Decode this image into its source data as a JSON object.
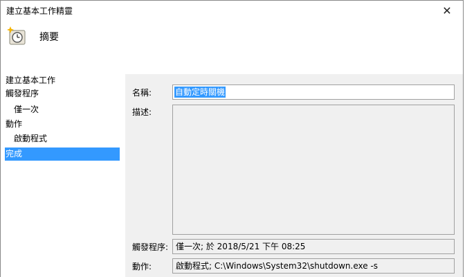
{
  "window": {
    "title": "建立基本工作精靈",
    "close_glyph": "✕"
  },
  "header": {
    "icon": "clock-sparkle-icon",
    "title": "摘要"
  },
  "sidebar": {
    "items": [
      {
        "label": "建立基本工作",
        "active": false
      },
      {
        "label": "觸發程序",
        "active": false
      },
      {
        "label": "僅一次",
        "active": false
      },
      {
        "label": "動作",
        "active": false
      },
      {
        "label": "啟動程式",
        "active": false
      },
      {
        "label": "完成",
        "active": true
      }
    ]
  },
  "form": {
    "name_label": "名稱:",
    "name_value": "自動定時關機",
    "description_label": "描述:",
    "description_value": "",
    "trigger_label": "觸發程序:",
    "trigger_value": "僅一次; 於 2018/5/21 下午 08:25",
    "action_label": "動作:",
    "action_value": "啟動程式; C:\\Windows\\System32\\shutdown.exe -s"
  },
  "colors": {
    "selection": "#3399ff",
    "panel_background": "#f0f0f0",
    "field_border": "#a0a0a0"
  }
}
